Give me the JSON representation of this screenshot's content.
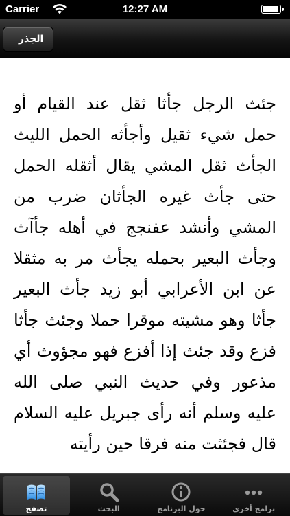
{
  "status_bar": {
    "carrier": "Carrier",
    "time": "12:27 AM",
    "battery_level": 0.9
  },
  "nav_bar": {
    "back_label": "الجذر"
  },
  "article": {
    "text": "جئث الرجل جأثا ثقل عند القيام أو حمل شيء ثقيل وأجأثه الحمل الليث الجأث ثقل المشي يقال أثقله الحمل حتى جأث غيره الجأثان ضرب من المشي وأنشد عفنجج في أهله جأآث وجأث البعير بحمله يجأث مر به مثقلا عن ابن الأعرابي أبو زيد جأث البعير جأثا وهو مشيته موقرا حملا وجئث جأثا فزع وقد جئث إذا أفزع فهو مجؤوث أي مذعور وفي حديث النبي صلى الله عليه وسلم أنه رأى جبريل عليه السلام قال فجئثت منه فرقا حين رأيته"
  },
  "tab_bar": {
    "active_color": "#5fb4ff",
    "tabs": [
      {
        "label": "تصفح",
        "icon": "book-icon",
        "active": true
      },
      {
        "label": "البحث",
        "icon": "magnifier-icon",
        "active": false
      },
      {
        "label": "حول البرنامج",
        "icon": "info-icon",
        "active": false
      },
      {
        "label": "برامج أخرى",
        "icon": "more-icon",
        "active": false
      }
    ]
  }
}
